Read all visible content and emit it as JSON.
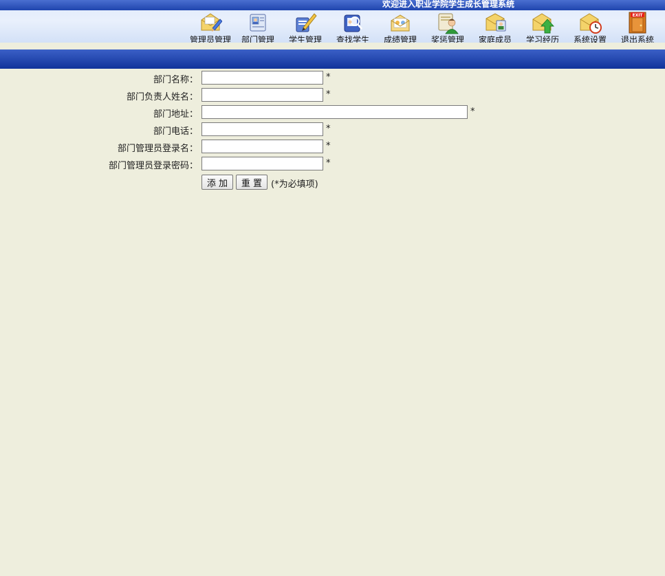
{
  "header": {
    "title": "欢迎进入职业学院学生成长管理系统",
    "nav": [
      {
        "label": "管理员管理",
        "icon": "admin-manage-icon"
      },
      {
        "label": "部门管理",
        "icon": "department-manage-icon"
      },
      {
        "label": "学生管理",
        "icon": "student-manage-icon"
      },
      {
        "label": "查找学生",
        "icon": "find-student-icon"
      },
      {
        "label": "成绩管理",
        "icon": "grade-manage-icon"
      },
      {
        "label": "奖惩管理",
        "icon": "reward-punish-icon"
      },
      {
        "label": "家庭成员",
        "icon": "family-members-icon"
      },
      {
        "label": "学习经历",
        "icon": "study-history-icon"
      },
      {
        "label": "系统设置",
        "icon": "system-settings-icon"
      },
      {
        "label": "退出系统",
        "icon": "exit-icon"
      }
    ],
    "exit_badge": "EXIT"
  },
  "form": {
    "fields": [
      {
        "label": "部门名称：",
        "value": "",
        "required": "*"
      },
      {
        "label": "部门负责人姓名：",
        "value": "",
        "required": "*"
      },
      {
        "label": "部门地址：",
        "value": "",
        "required": "*"
      },
      {
        "label": "部门电话：",
        "value": "",
        "required": "*"
      },
      {
        "label": "部门管理员登录名：",
        "value": "",
        "required": "*"
      },
      {
        "label": "部门管理员登录密码：",
        "value": "",
        "required": "*"
      }
    ],
    "add_label": "添 加",
    "reset_label": "重 置",
    "hint": "(*为必填项)"
  },
  "colors": {
    "page_bg": "#eeeedd",
    "header_bar": "#1f45ae",
    "accent_bar": "#11339a"
  }
}
